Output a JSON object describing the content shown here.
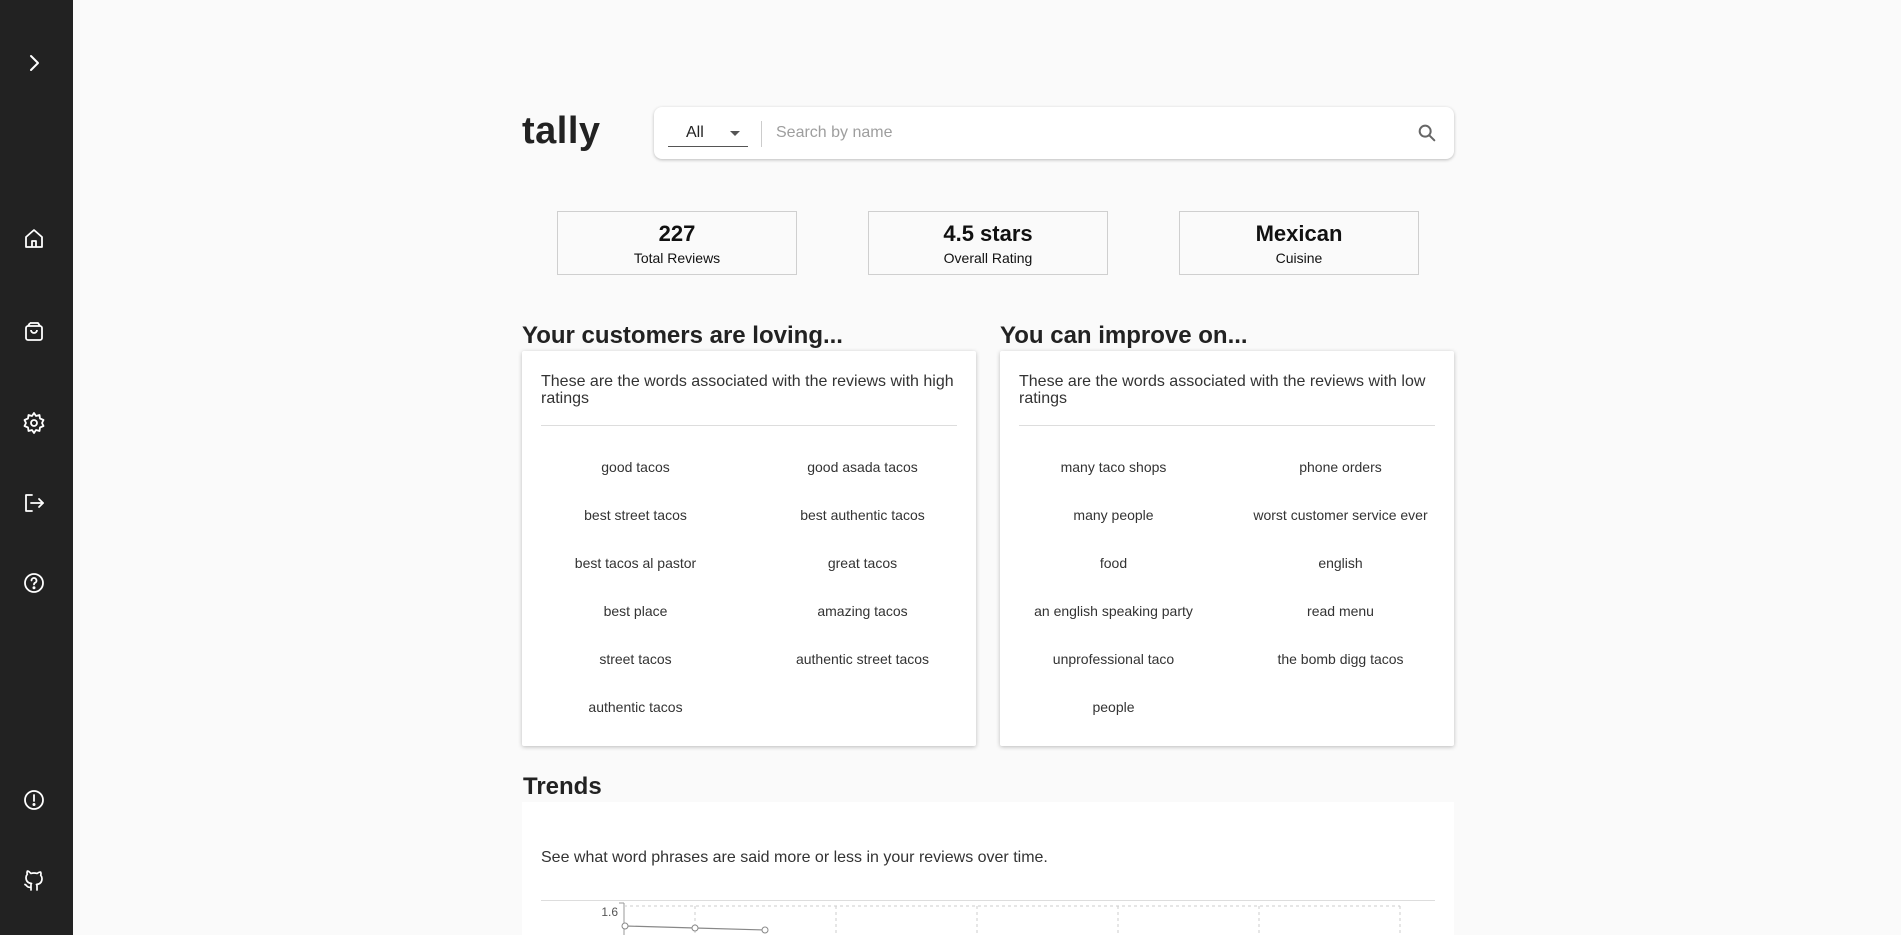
{
  "sidebar": {
    "icons": [
      "chevron-right-icon",
      "home-icon",
      "shopping-bag-icon",
      "gear-icon",
      "logout-icon",
      "help-icon",
      "alert-icon",
      "github-icon"
    ]
  },
  "header": {
    "logo": "tally",
    "filter_value": "All",
    "search_placeholder": "Search by name"
  },
  "stats": [
    {
      "value": "227",
      "label": "Total Reviews"
    },
    {
      "value": "4.5 stars",
      "label": "Overall Rating"
    },
    {
      "value": "Mexican",
      "label": "Cuisine"
    }
  ],
  "loving": {
    "title": "Your customers are loving...",
    "description": "These are the words associated with the reviews with high ratings",
    "phrases": [
      "good tacos",
      "good asada tacos",
      "best street tacos",
      "best authentic tacos",
      "best tacos al pastor",
      "great tacos",
      "best place",
      "amazing tacos",
      "street tacos",
      "authentic street tacos",
      "authentic tacos"
    ]
  },
  "improve": {
    "title": "You can improve on...",
    "description": "These are the words associated with the reviews with low ratings",
    "phrases": [
      "many taco shops",
      "phone orders",
      "many people",
      "worst customer service ever",
      "food",
      "english",
      "an english speaking party",
      "read menu",
      "unprofessional taco",
      "the bomb digg tacos",
      "people"
    ]
  },
  "trends": {
    "title": "Trends",
    "description": "See what word phrases are said more or less in your reviews over time.",
    "chart": {
      "y_tick_top": "1.6",
      "points": [
        1.6,
        1.59,
        1.58
      ]
    }
  }
}
